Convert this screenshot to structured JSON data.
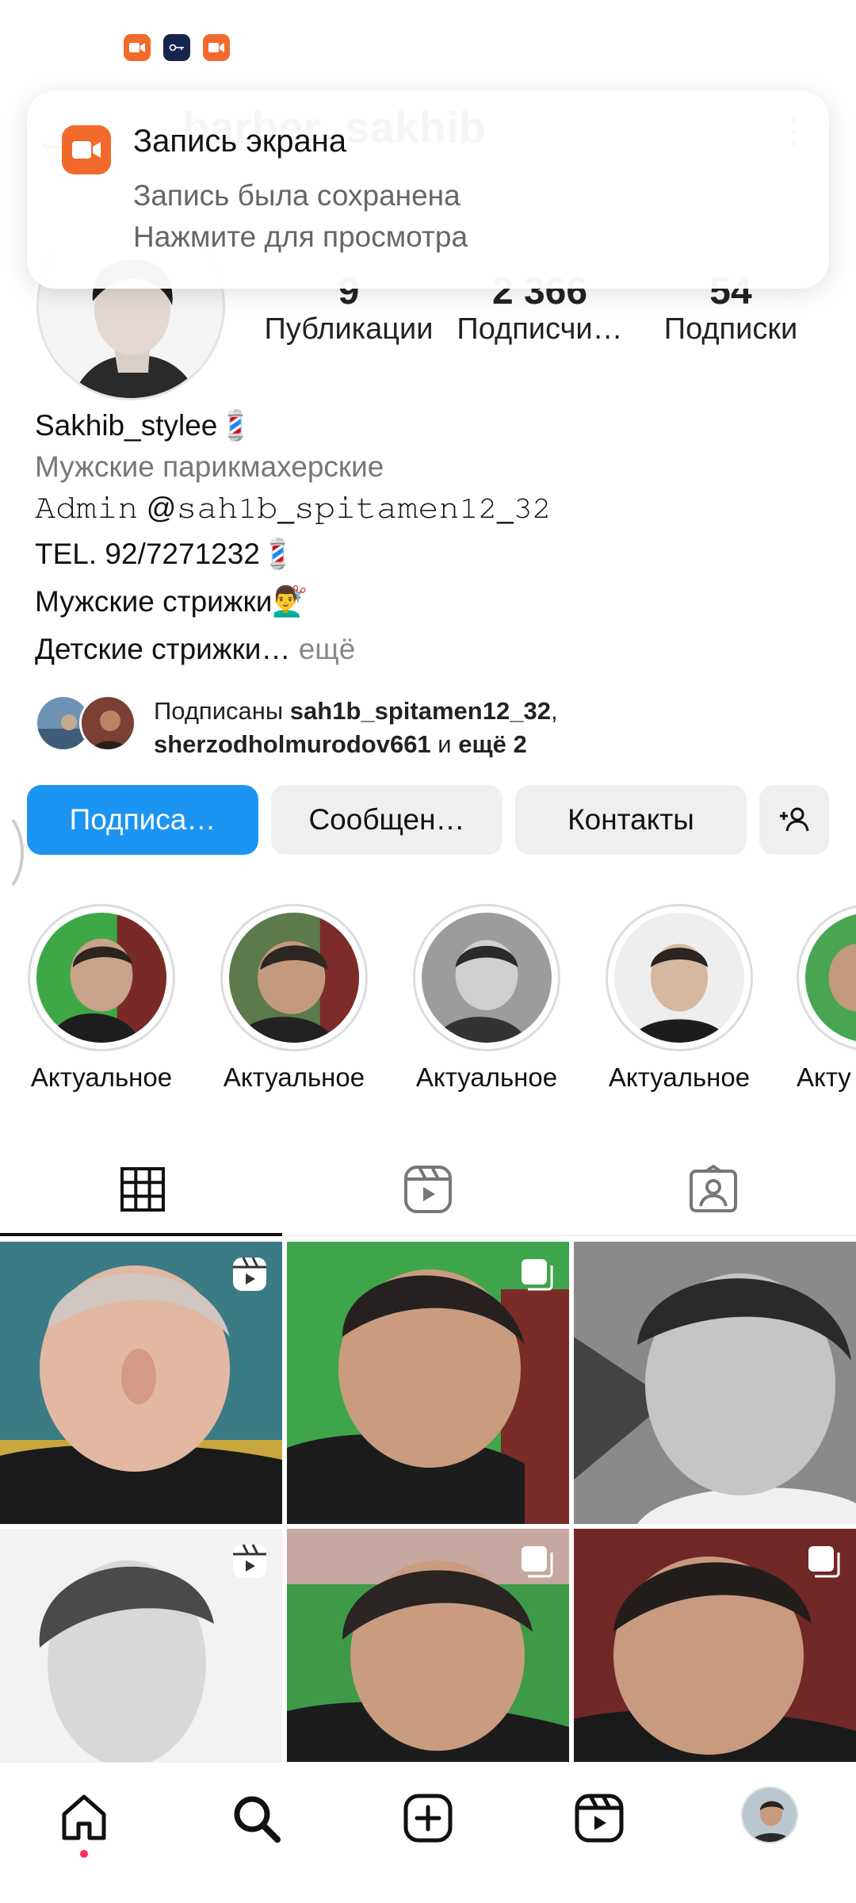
{
  "header": {
    "title": "barber_sakhib",
    "back_glyph": "←",
    "menu_glyph": "⋮"
  },
  "toast": {
    "title": "Запись экрана",
    "line1": "Запись была сохранена",
    "line2": "Нажмите для просмотра"
  },
  "profile": {
    "stats": [
      {
        "value": "9",
        "label": "Публикации"
      },
      {
        "value": "2 366",
        "label": "Подписчи…"
      },
      {
        "value": "54",
        "label": "Подписки"
      }
    ],
    "name": "Sakhib_stylee💈",
    "category": "Мужские парикмахерские",
    "bio_line1": "𝙰𝚍𝚖𝚒𝚗 @𝚜𝚊𝚑𝟷𝚋_𝚜𝚙𝚒𝚝𝚊𝚖𝚎𝚗𝟷𝟸_𝟹𝟸",
    "bio_line2": "TEL. 92/7271232💈",
    "bio_line3": "Мужские стрижки💇‍♂️",
    "bio_line4": "Детские стрижки…",
    "more": " ещё",
    "followed_by_prefix": "Подписаны ",
    "followed_by_user1": "sah1b_spitamen12_32",
    "followed_by_comma": ",",
    "followed_by_user2": "sherzodholmurodov661",
    "followed_by_and": " и ",
    "followed_by_more": "ещё 2"
  },
  "buttons": {
    "follow": "Подписа…",
    "message": "Сообщен…",
    "contacts": "Контакты"
  },
  "highlights": [
    {
      "label": "Актуальное"
    },
    {
      "label": "Актуальное"
    },
    {
      "label": "Актуальное"
    },
    {
      "label": "Актуальное"
    },
    {
      "label": "Акту"
    }
  ],
  "tabs": [
    "grid-icon",
    "reels-icon",
    "tagged-icon"
  ],
  "nav": [
    "home-icon",
    "search-icon",
    "create-icon",
    "reels-icon",
    "profile-avatar"
  ],
  "colors": {
    "accent": "#1c95f2",
    "record": "#f26a2b",
    "notification_dot": "#ff2d55"
  }
}
